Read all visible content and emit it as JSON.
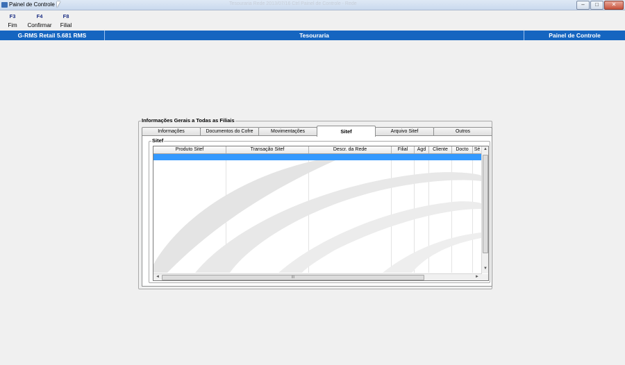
{
  "window": {
    "title": "Painel de Controle",
    "ghost_title": "Tesouraria  Rede  2013/07/16  Ctrl  Painel de Controle  -  Rede",
    "buttons": {
      "minimize": "–",
      "maximize": "□",
      "close": "✕"
    }
  },
  "toolbar": {
    "keys": [
      {
        "key": "F3",
        "label": "Fim"
      },
      {
        "key": "F4",
        "label": "Confirmar"
      },
      {
        "key": "F8",
        "label": "Filial"
      }
    ]
  },
  "header": {
    "left": "G-RMS Retail 5.681 RMS",
    "center": "Tesouraria",
    "right": "Painel de Controle",
    "color": "#1565c0"
  },
  "group": {
    "title": "Informações Gerais a Todas as Filiais",
    "tabs": [
      "Informações",
      "Documentos do Cofre",
      "Movimentações",
      "Sitef",
      "Arquivo  Sitef",
      "Outros"
    ],
    "active_tab": "Sitef"
  },
  "sitef": {
    "title": "Sitef",
    "columns": [
      "Produto Sitef",
      "Transação Sitef",
      "Descr. da Rede",
      "Filial",
      "Agd",
      "Cliente",
      "Docto",
      "Sé"
    ],
    "selected_color": "#3399ff",
    "hscroll_grip": "III"
  },
  "icons": [
    "app-icon",
    "cursor-icon",
    "scroll-up-icon",
    "scroll-down-icon",
    "scroll-left-icon",
    "scroll-right-icon",
    "watermark-swoosh"
  ]
}
